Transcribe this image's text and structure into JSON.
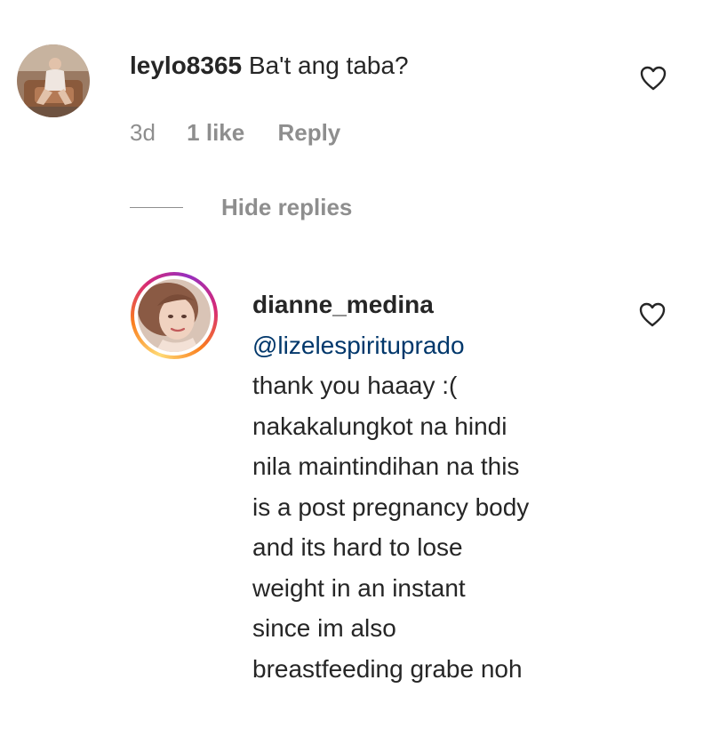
{
  "comment": {
    "username": "leylo8365",
    "text": "Ba't ang taba?",
    "time": "3d",
    "likes": "1 like",
    "reply_label": "Reply"
  },
  "replies_toggle": {
    "label": "Hide replies"
  },
  "reply": {
    "username": "dianne_medina",
    "mention": "@lizelespirituprado",
    "lines": [
      "thank you haaay :(",
      "nakakalungkot na hindi",
      "nila maintindihan na this",
      "is a post pregnancy body",
      "and its hard to lose",
      "weight in an instant",
      "since im also",
      "breastfeeding grabe noh"
    ]
  },
  "colors": {
    "text": "#262626",
    "secondary": "#8e8e8e",
    "mention": "#00376b"
  },
  "icons": {
    "like": "heart-outline-icon"
  }
}
